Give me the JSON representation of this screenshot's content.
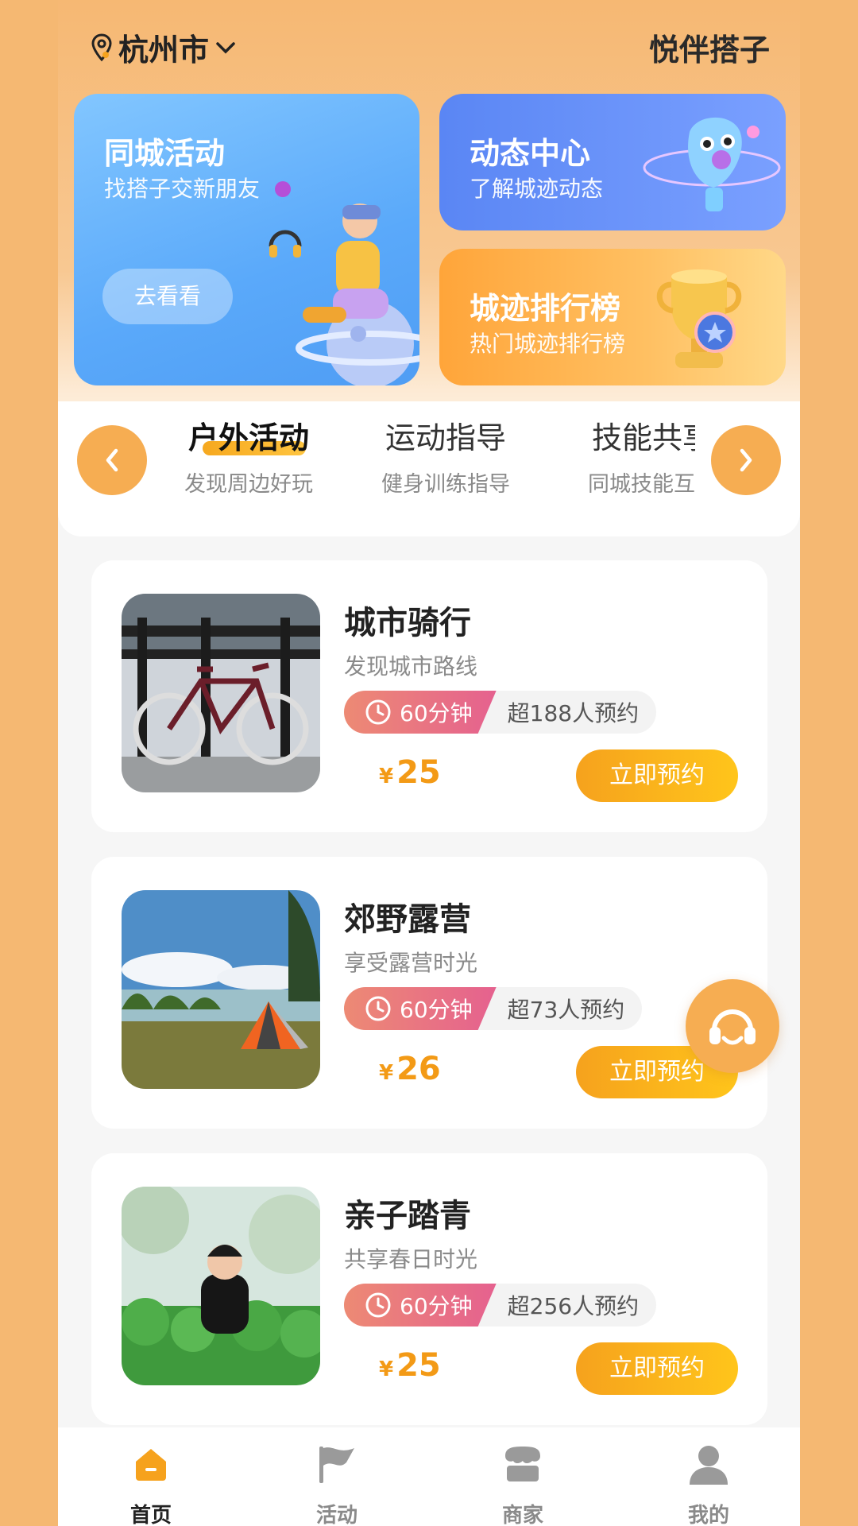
{
  "header": {
    "city": "杭州市",
    "brand": "悦伴搭子"
  },
  "cards": {
    "city_activity": {
      "title": "同城活动",
      "subtitle": "找搭子交新朋友",
      "button": "去看看"
    },
    "dynamic_center": {
      "title": "动态中心",
      "subtitle": "了解城迹动态"
    },
    "ranking": {
      "title": "城迹排行榜",
      "subtitle": "热门城迹排行榜"
    }
  },
  "categories": [
    {
      "title": "户外活动",
      "subtitle": "发现周边好玩",
      "active": true
    },
    {
      "title": "运动指导",
      "subtitle": "健身训练指导",
      "active": false
    },
    {
      "title": "技能共享",
      "subtitle": "同城技能互助",
      "active": false
    }
  ],
  "items": [
    {
      "title": "城市骑行",
      "subtitle": "发现城市路线",
      "duration": "60分钟",
      "booked": "超188人预约",
      "currency": "¥",
      "price": "25",
      "button": "立即预约"
    },
    {
      "title": "郊野露营",
      "subtitle": "享受露营时光",
      "duration": "60分钟",
      "booked": "超73人预约",
      "currency": "¥",
      "price": "26",
      "button": "立即预约"
    },
    {
      "title": "亲子踏青",
      "subtitle": "共享春日时光",
      "duration": "60分钟",
      "booked": "超256人预约",
      "currency": "¥",
      "price": "25",
      "button": "立即预约"
    }
  ],
  "tabbar": [
    {
      "label": "首页",
      "icon": "home-icon",
      "active": true
    },
    {
      "label": "活动",
      "icon": "flag-icon",
      "active": false
    },
    {
      "label": "商家",
      "icon": "shop-icon",
      "active": false
    },
    {
      "label": "我的",
      "icon": "user-icon",
      "active": false
    }
  ],
  "colors": {
    "accent": "#f6ad52",
    "price": "#f39a16",
    "button": "#ffb41d"
  }
}
